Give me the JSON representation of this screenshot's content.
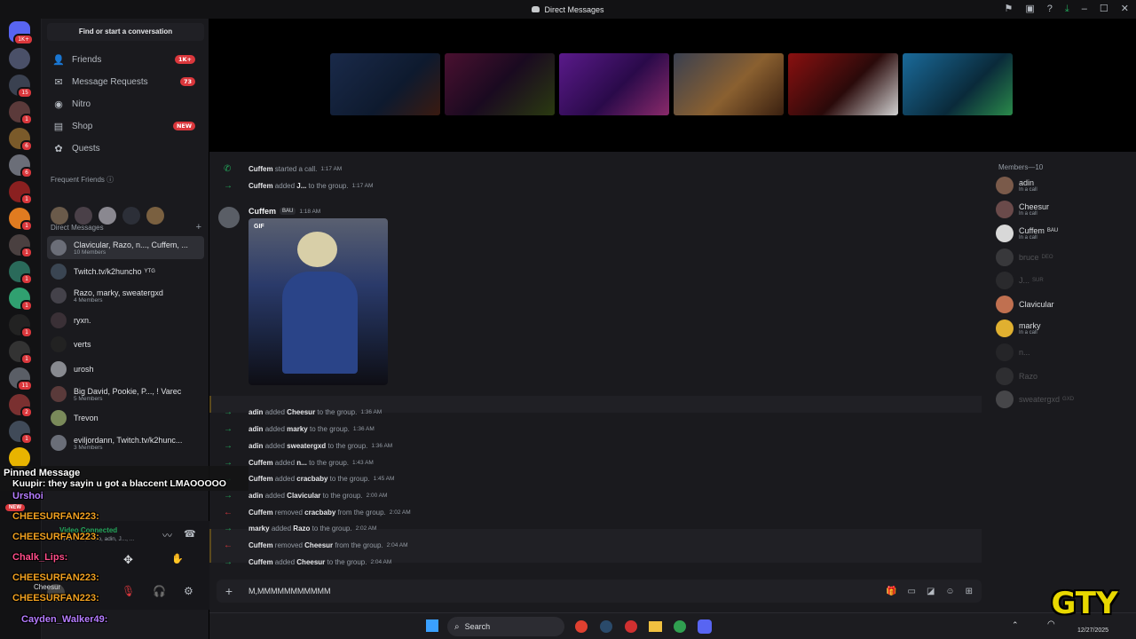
{
  "window": {
    "title": "Direct Messages",
    "rail_badge_top": "1K+"
  },
  "rail": {
    "badges": [
      "15",
      "1",
      "6",
      "6",
      "1",
      "1",
      "1",
      "1",
      "1",
      "1",
      "1",
      "11",
      "2",
      "1"
    ]
  },
  "sidebar": {
    "search_placeholder": "Find or start a conversation",
    "nav": [
      {
        "label": "Friends",
        "badge": "1K+"
      },
      {
        "label": "Message Requests",
        "badge": "73"
      },
      {
        "label": "Nitro",
        "badge": ""
      },
      {
        "label": "Shop",
        "badge": "NEW"
      },
      {
        "label": "Quests",
        "badge": ""
      }
    ],
    "frequent_friends_label": "Frequent Friends",
    "direct_messages_label": "Direct Messages",
    "dms": [
      {
        "name": "Clavicular, Razo, n..., Cuffem, ...",
        "sub": "10 Members",
        "tag": ""
      },
      {
        "name": "Twitch.tv/k2huncho",
        "sub": "",
        "tag": "YTG"
      },
      {
        "name": "Razo, marky, sweatergxd",
        "sub": "4 Members",
        "tag": ""
      },
      {
        "name": "ryxn.",
        "sub": "",
        "tag": ""
      },
      {
        "name": "verts",
        "sub": "",
        "tag": ""
      },
      {
        "name": "urosh",
        "sub": "",
        "tag": ""
      },
      {
        "name": "Big David, Pookie, P..., ! Varec",
        "sub": "5 Members",
        "tag": ""
      },
      {
        "name": "Trevon",
        "sub": "",
        "tag": ""
      },
      {
        "name": "eviljordann, Twitch.tv/k2hunc...",
        "sub": "3 Members",
        "tag": ""
      }
    ],
    "voice_status": "Video Connected",
    "voice_sub": "Clavicular, Razo, adin, J..., ...",
    "user_name": "Cheesur"
  },
  "chat": {
    "messages": [
      {
        "kind": "call",
        "user": "Cuffem",
        "action": "started a call.",
        "target": "",
        "rest": "",
        "time": "1:17 AM"
      },
      {
        "kind": "add",
        "user": "Cuffem",
        "action": "added",
        "target": "J...",
        "rest": "to the group.",
        "time": "1:17 AM"
      }
    ],
    "post": {
      "author": "Cuffem",
      "tag": "BAU",
      "time": "1:18 AM",
      "gif_label": "GIF"
    },
    "events": [
      {
        "kind": "add",
        "user": "adin",
        "action": "added",
        "target": "Cheesur",
        "rest": "to the group.",
        "time": "1:36 AM"
      },
      {
        "kind": "add",
        "user": "adin",
        "action": "added",
        "target": "marky",
        "rest": "to the group.",
        "time": "1:36 AM"
      },
      {
        "kind": "add",
        "user": "adin",
        "action": "added",
        "target": "sweatergxd",
        "rest": "to the group.",
        "time": "1:36 AM"
      },
      {
        "kind": "add",
        "user": "Cuffem",
        "action": "added",
        "target": "n...",
        "rest": "to the group.",
        "time": "1:43 AM"
      },
      {
        "kind": "add",
        "user": "Cuffem",
        "action": "added",
        "target": "cracbaby",
        "rest": "to the group.",
        "time": "1:45 AM"
      },
      {
        "kind": "add",
        "user": "adin",
        "action": "added",
        "target": "Clavicular",
        "rest": "to the group.",
        "time": "2:00 AM"
      },
      {
        "kind": "remove",
        "user": "Cuffem",
        "action": "removed",
        "target": "cracbaby",
        "rest": "from the group.",
        "time": "2:02 AM"
      },
      {
        "kind": "add",
        "user": "marky",
        "action": "added",
        "target": "Razo",
        "rest": "to the group.",
        "time": "2:02 AM"
      },
      {
        "kind": "remove",
        "user": "Cuffem",
        "action": "removed",
        "target": "Cheesur",
        "rest": "from the group.",
        "time": "2:04 AM"
      },
      {
        "kind": "add",
        "user": "Cuffem",
        "action": "added",
        "target": "Cheesur",
        "rest": "to the group.",
        "time": "2:04 AM"
      }
    ],
    "composer_value": "M,MMMMMMMMMMM"
  },
  "members": {
    "header": "Members—10",
    "list": [
      {
        "name": "adin",
        "status": "In a call",
        "tag": "",
        "dim": false
      },
      {
        "name": "Cheesur",
        "status": "In a call",
        "tag": "",
        "dim": false
      },
      {
        "name": "Cuffem",
        "status": "In a call",
        "tag": "BAU",
        "dim": false
      },
      {
        "name": "bruce",
        "status": "",
        "tag": "DEO",
        "dim": true
      },
      {
        "name": "J...",
        "status": "",
        "tag": "SUR",
        "dim": true
      },
      {
        "name": "Clavicular",
        "status": "",
        "tag": "",
        "dim": false
      },
      {
        "name": "marky",
        "status": "In a call",
        "tag": "",
        "dim": false
      },
      {
        "name": "n...",
        "status": "",
        "tag": "",
        "dim": true
      },
      {
        "name": "Razo",
        "status": "",
        "tag": "",
        "dim": true
      },
      {
        "name": "sweatergxd",
        "status": "",
        "tag": "GXD",
        "dim": true
      }
    ]
  },
  "overlay": {
    "pinned_label": "Pinned Message",
    "pinned_text": "Kuupir: they sayin u got a blaccent LMAOOOOO",
    "new_badge": "NEW",
    "chat_lines": [
      {
        "name": "Urshoi",
        "color": "#b57cff"
      },
      {
        "name": "CHEESURFAN223:",
        "color": "#f0a020"
      },
      {
        "name": "CHEESURFAN223:",
        "color": "#f0a020"
      },
      {
        "name": "Chalk_Lips:",
        "color": "#ff4d8a"
      },
      {
        "name": "CHEESURFAN223:",
        "color": "#f0a020"
      },
      {
        "name": "CHEESURFAN223:",
        "color": "#f0a020"
      },
      {
        "name": "Cayden_Walker49:",
        "color": "#b57cff"
      }
    ],
    "logo_text": "GTY"
  },
  "taskbar": {
    "search_label": "Search",
    "date": "12/27/2025"
  }
}
